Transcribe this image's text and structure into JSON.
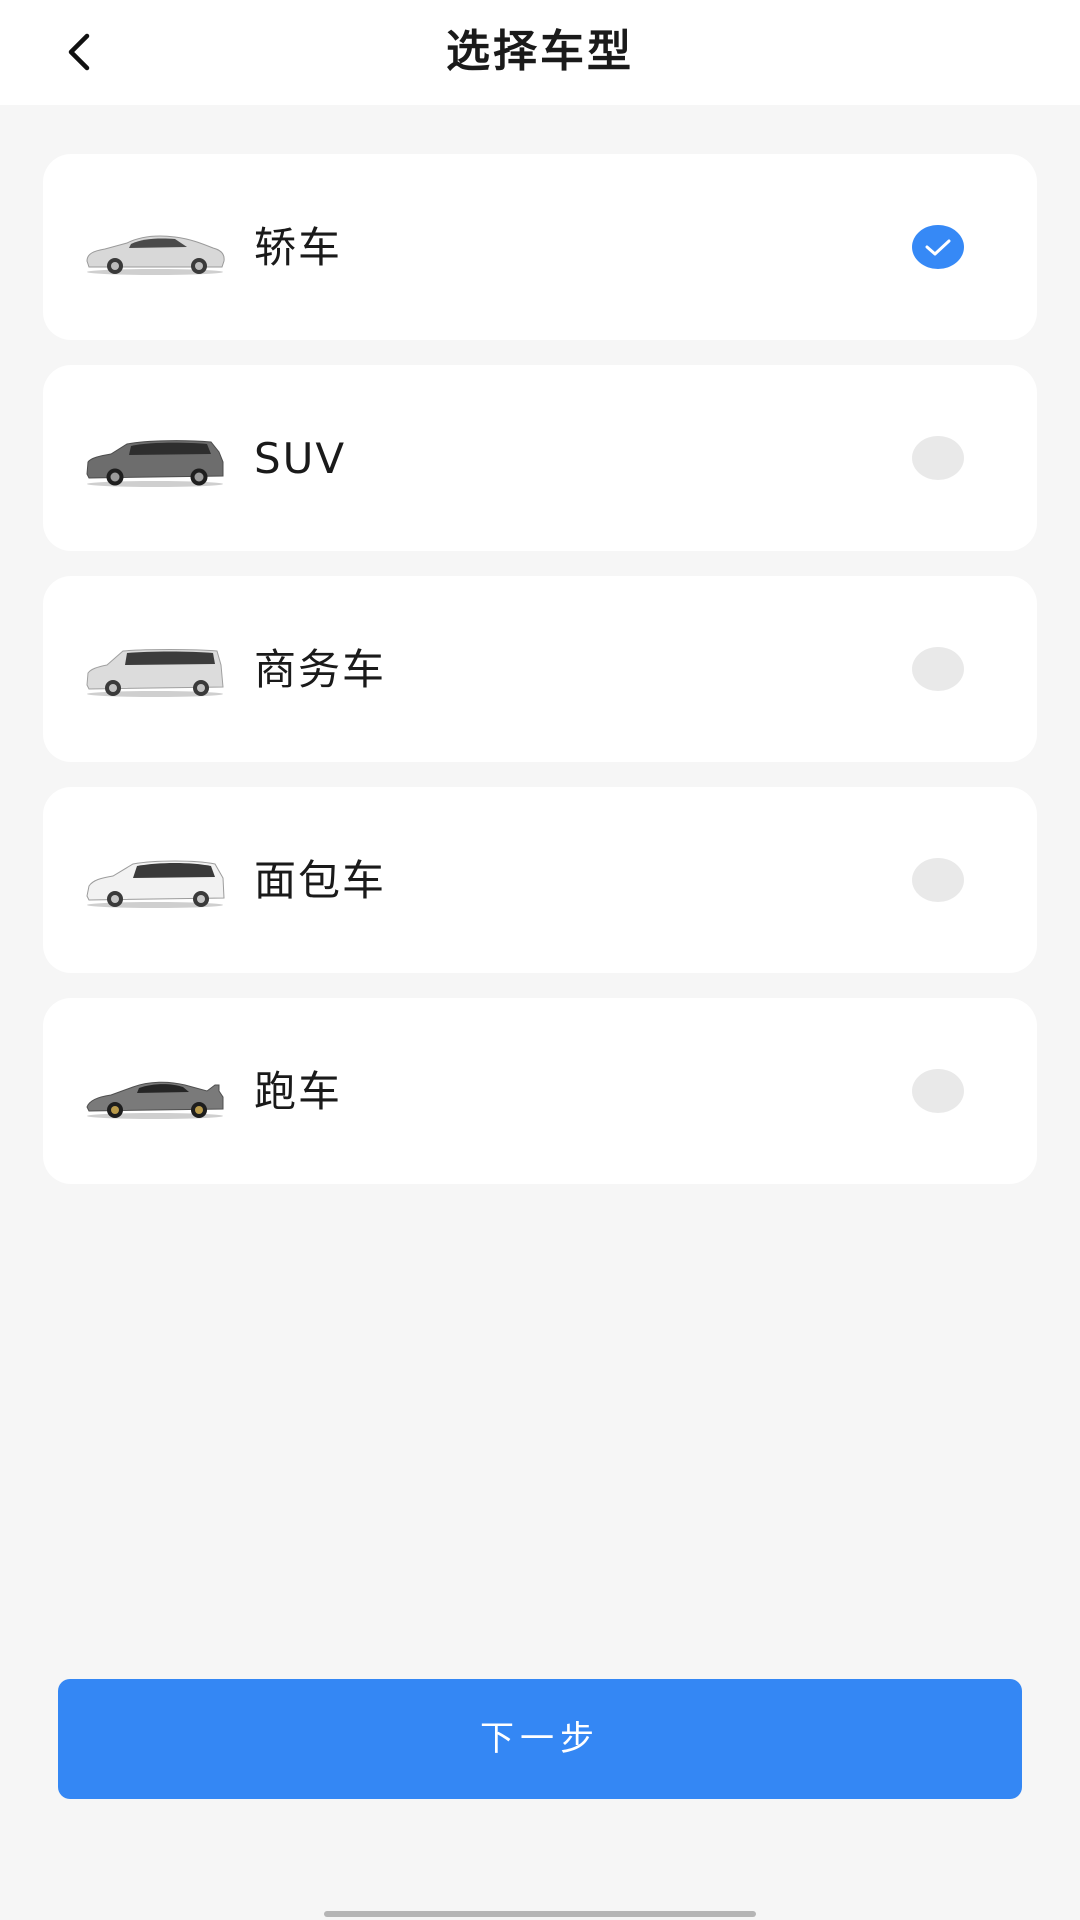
{
  "header": {
    "title": "选择车型",
    "back_icon": "chevron-left-icon"
  },
  "car_types": [
    {
      "label": "轿车",
      "selected": true,
      "icon": "sedan-car-icon",
      "color": "#d8d8d8"
    },
    {
      "label": "SUV",
      "selected": false,
      "icon": "suv-car-icon",
      "color": "#6d6d6d"
    },
    {
      "label": "商务车",
      "selected": false,
      "icon": "business-van-icon",
      "color": "#dcdcdc"
    },
    {
      "label": "面包车",
      "selected": false,
      "icon": "minivan-icon",
      "color": "#f2f2f2"
    },
    {
      "label": "跑车",
      "selected": false,
      "icon": "sports-car-icon",
      "color": "#7a7a7a"
    }
  ],
  "footer": {
    "next_label": "下一步"
  },
  "colors": {
    "accent": "#3487f4",
    "radio_unchecked": "#e9e9e9",
    "background": "#f6f6f6",
    "card": "#ffffff"
  }
}
